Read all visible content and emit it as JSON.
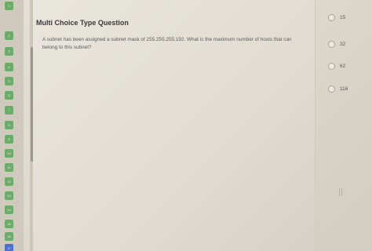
{
  "question": {
    "title": "Multi Choice Type Question",
    "text": "A subnet has been assigned a subnet mask of 255.255.255.192. What is the maximum number of hosts that can belong to this subnet?"
  },
  "options": [
    {
      "label": "15"
    },
    {
      "label": "32"
    },
    {
      "label": "62"
    },
    {
      "label": "116"
    }
  ],
  "nav": {
    "items": [
      "1",
      "2",
      "3",
      "4",
      "5",
      "6",
      "7",
      "8",
      "9",
      "10",
      "11",
      "12",
      "13",
      "14",
      "15",
      "16",
      "17"
    ],
    "current_color": "#4a6fd0",
    "answered_color": "#6cab6a"
  }
}
